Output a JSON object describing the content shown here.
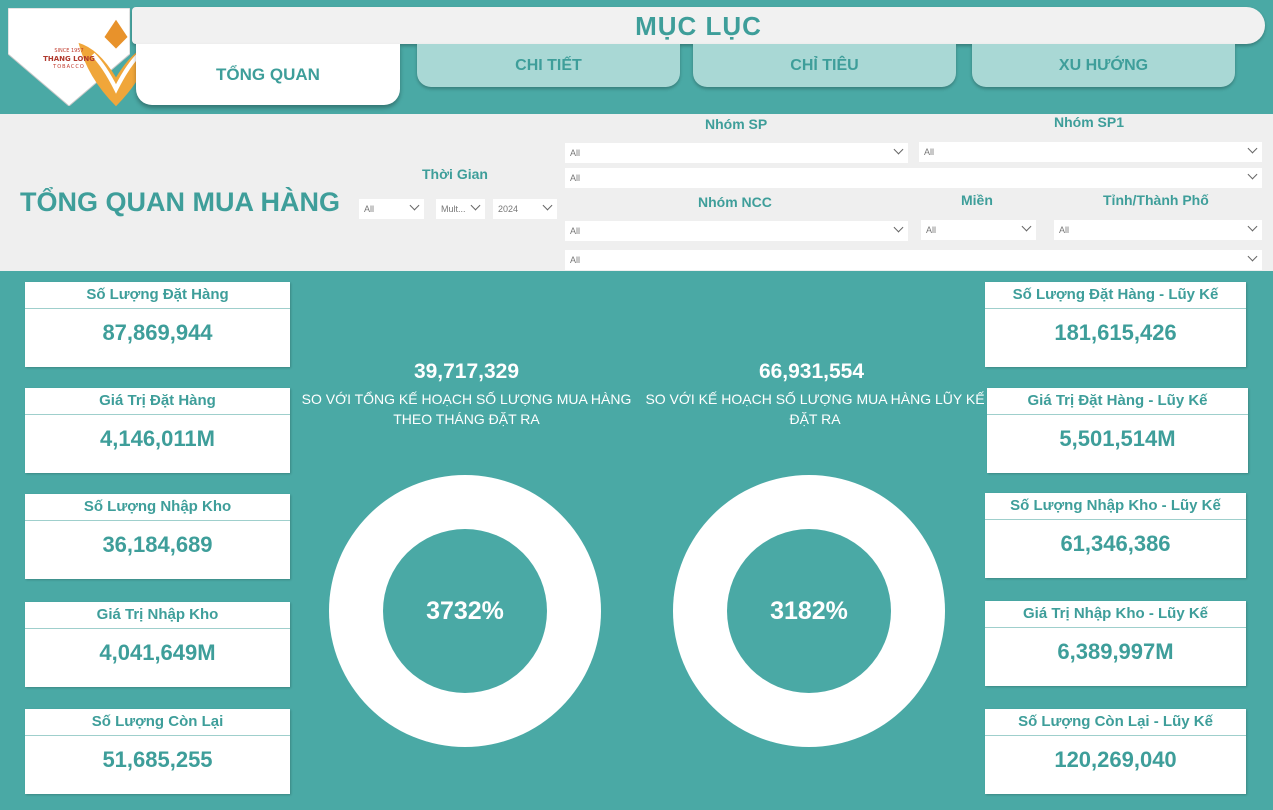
{
  "header": {
    "title": "MỤC LỤC",
    "logo": {
      "since": "SINCE 1957",
      "name": "THANG LONG",
      "sub": "TOBACCO"
    },
    "tabs": [
      {
        "label": "TỔNG QUAN",
        "active": true
      },
      {
        "label": "CHI TIẾT",
        "active": false
      },
      {
        "label": "CHỈ TIÊU",
        "active": false
      },
      {
        "label": "XU HƯỚNG",
        "active": false
      }
    ]
  },
  "filters": {
    "page_heading": "TỔNG QUAN MUA HÀNG",
    "time": {
      "label": "Thời Gian",
      "values": [
        "All",
        "Mult...",
        "2024"
      ]
    },
    "nhom_sp": {
      "label": "Nhóm SP",
      "value": "All"
    },
    "nhom_sp1": {
      "label": "Nhóm SP1",
      "value": "All"
    },
    "row2": {
      "value": "All"
    },
    "nhom_ncc": {
      "label": "Nhóm NCC",
      "value": "All"
    },
    "mien": {
      "label": "Miền",
      "value": "All"
    },
    "tinh": {
      "label": "Tỉnh/Thành Phố",
      "value": "All"
    },
    "row4": {
      "value": "All"
    }
  },
  "left_cards": [
    {
      "label": "Số Lượng Đặt Hàng",
      "value": "87,869,944"
    },
    {
      "label": "Giá Trị Đặt Hàng",
      "value": "4,146,011M"
    },
    {
      "label": "Số Lượng Nhập Kho",
      "value": "36,184,689"
    },
    {
      "label": "Giá Trị Nhập Kho",
      "value": "4,041,649M"
    },
    {
      "label": "Số Lượng Còn Lại",
      "value": "51,685,255"
    }
  ],
  "right_cards": [
    {
      "label": "Số Lượng Đặt Hàng - Lũy Kế",
      "value": "181,615,426"
    },
    {
      "label": "Giá Trị Đặt Hàng - Lũy Kế",
      "value": "5,501,514M"
    },
    {
      "label": "Số Lượng Nhập Kho - Lũy Kế",
      "value": "61,346,386"
    },
    {
      "label": "Giá Trị Nhập Kho - Lũy Kế",
      "value": "6,389,997M"
    },
    {
      "label": "Số Lượng Còn Lại - Lũy Kế",
      "value": "120,269,040"
    }
  ],
  "gauges": [
    {
      "number": "39,717,329",
      "line1": "SO VỚI TỔNG KẾ HOẠCH SỐ LƯỢNG MUA HÀNG",
      "line2": "THEO THÁNG ĐẶT RA",
      "percent": "3732%"
    },
    {
      "number": "66,931,554",
      "line1": "SO VỚI KẾ HOẠCH SỐ LƯỢNG MUA HÀNG LŨY KẾ",
      "line2": "ĐẶT RA",
      "percent": "3182%"
    }
  ],
  "colors": {
    "teal": "#4aa9a5",
    "teal_text": "#3e9e9a",
    "tab_inactive": "#a9d8d5",
    "logo_orange": "#e8922b",
    "logo_red": "#c0392b"
  }
}
